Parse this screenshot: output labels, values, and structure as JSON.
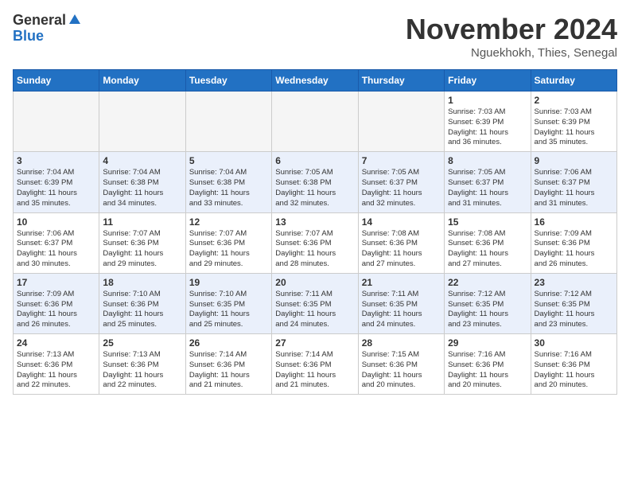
{
  "header": {
    "logo_general": "General",
    "logo_blue": "Blue",
    "month_title": "November 2024",
    "location": "Nguekhokh, Thies, Senegal"
  },
  "weekdays": [
    "Sunday",
    "Monday",
    "Tuesday",
    "Wednesday",
    "Thursday",
    "Friday",
    "Saturday"
  ],
  "weeks": [
    [
      {
        "day": "",
        "empty": true
      },
      {
        "day": "",
        "empty": true
      },
      {
        "day": "",
        "empty": true
      },
      {
        "day": "",
        "empty": true
      },
      {
        "day": "",
        "empty": true
      },
      {
        "day": "1",
        "info": "Sunrise: 7:03 AM\nSunset: 6:39 PM\nDaylight: 11 hours\nand 36 minutes."
      },
      {
        "day": "2",
        "info": "Sunrise: 7:03 AM\nSunset: 6:39 PM\nDaylight: 11 hours\nand 35 minutes."
      }
    ],
    [
      {
        "day": "3",
        "info": "Sunrise: 7:04 AM\nSunset: 6:39 PM\nDaylight: 11 hours\nand 35 minutes."
      },
      {
        "day": "4",
        "info": "Sunrise: 7:04 AM\nSunset: 6:38 PM\nDaylight: 11 hours\nand 34 minutes."
      },
      {
        "day": "5",
        "info": "Sunrise: 7:04 AM\nSunset: 6:38 PM\nDaylight: 11 hours\nand 33 minutes."
      },
      {
        "day": "6",
        "info": "Sunrise: 7:05 AM\nSunset: 6:38 PM\nDaylight: 11 hours\nand 32 minutes."
      },
      {
        "day": "7",
        "info": "Sunrise: 7:05 AM\nSunset: 6:37 PM\nDaylight: 11 hours\nand 32 minutes."
      },
      {
        "day": "8",
        "info": "Sunrise: 7:05 AM\nSunset: 6:37 PM\nDaylight: 11 hours\nand 31 minutes."
      },
      {
        "day": "9",
        "info": "Sunrise: 7:06 AM\nSunset: 6:37 PM\nDaylight: 11 hours\nand 31 minutes."
      }
    ],
    [
      {
        "day": "10",
        "info": "Sunrise: 7:06 AM\nSunset: 6:37 PM\nDaylight: 11 hours\nand 30 minutes."
      },
      {
        "day": "11",
        "info": "Sunrise: 7:07 AM\nSunset: 6:36 PM\nDaylight: 11 hours\nand 29 minutes."
      },
      {
        "day": "12",
        "info": "Sunrise: 7:07 AM\nSunset: 6:36 PM\nDaylight: 11 hours\nand 29 minutes."
      },
      {
        "day": "13",
        "info": "Sunrise: 7:07 AM\nSunset: 6:36 PM\nDaylight: 11 hours\nand 28 minutes."
      },
      {
        "day": "14",
        "info": "Sunrise: 7:08 AM\nSunset: 6:36 PM\nDaylight: 11 hours\nand 27 minutes."
      },
      {
        "day": "15",
        "info": "Sunrise: 7:08 AM\nSunset: 6:36 PM\nDaylight: 11 hours\nand 27 minutes."
      },
      {
        "day": "16",
        "info": "Sunrise: 7:09 AM\nSunset: 6:36 PM\nDaylight: 11 hours\nand 26 minutes."
      }
    ],
    [
      {
        "day": "17",
        "info": "Sunrise: 7:09 AM\nSunset: 6:36 PM\nDaylight: 11 hours\nand 26 minutes."
      },
      {
        "day": "18",
        "info": "Sunrise: 7:10 AM\nSunset: 6:36 PM\nDaylight: 11 hours\nand 25 minutes."
      },
      {
        "day": "19",
        "info": "Sunrise: 7:10 AM\nSunset: 6:35 PM\nDaylight: 11 hours\nand 25 minutes."
      },
      {
        "day": "20",
        "info": "Sunrise: 7:11 AM\nSunset: 6:35 PM\nDaylight: 11 hours\nand 24 minutes."
      },
      {
        "day": "21",
        "info": "Sunrise: 7:11 AM\nSunset: 6:35 PM\nDaylight: 11 hours\nand 24 minutes."
      },
      {
        "day": "22",
        "info": "Sunrise: 7:12 AM\nSunset: 6:35 PM\nDaylight: 11 hours\nand 23 minutes."
      },
      {
        "day": "23",
        "info": "Sunrise: 7:12 AM\nSunset: 6:35 PM\nDaylight: 11 hours\nand 23 minutes."
      }
    ],
    [
      {
        "day": "24",
        "info": "Sunrise: 7:13 AM\nSunset: 6:36 PM\nDaylight: 11 hours\nand 22 minutes."
      },
      {
        "day": "25",
        "info": "Sunrise: 7:13 AM\nSunset: 6:36 PM\nDaylight: 11 hours\nand 22 minutes."
      },
      {
        "day": "26",
        "info": "Sunrise: 7:14 AM\nSunset: 6:36 PM\nDaylight: 11 hours\nand 21 minutes."
      },
      {
        "day": "27",
        "info": "Sunrise: 7:14 AM\nSunset: 6:36 PM\nDaylight: 11 hours\nand 21 minutes."
      },
      {
        "day": "28",
        "info": "Sunrise: 7:15 AM\nSunset: 6:36 PM\nDaylight: 11 hours\nand 20 minutes."
      },
      {
        "day": "29",
        "info": "Sunrise: 7:16 AM\nSunset: 6:36 PM\nDaylight: 11 hours\nand 20 minutes."
      },
      {
        "day": "30",
        "info": "Sunrise: 7:16 AM\nSunset: 6:36 PM\nDaylight: 11 hours\nand 20 minutes."
      }
    ]
  ],
  "shaded_rows": [
    1,
    3
  ]
}
